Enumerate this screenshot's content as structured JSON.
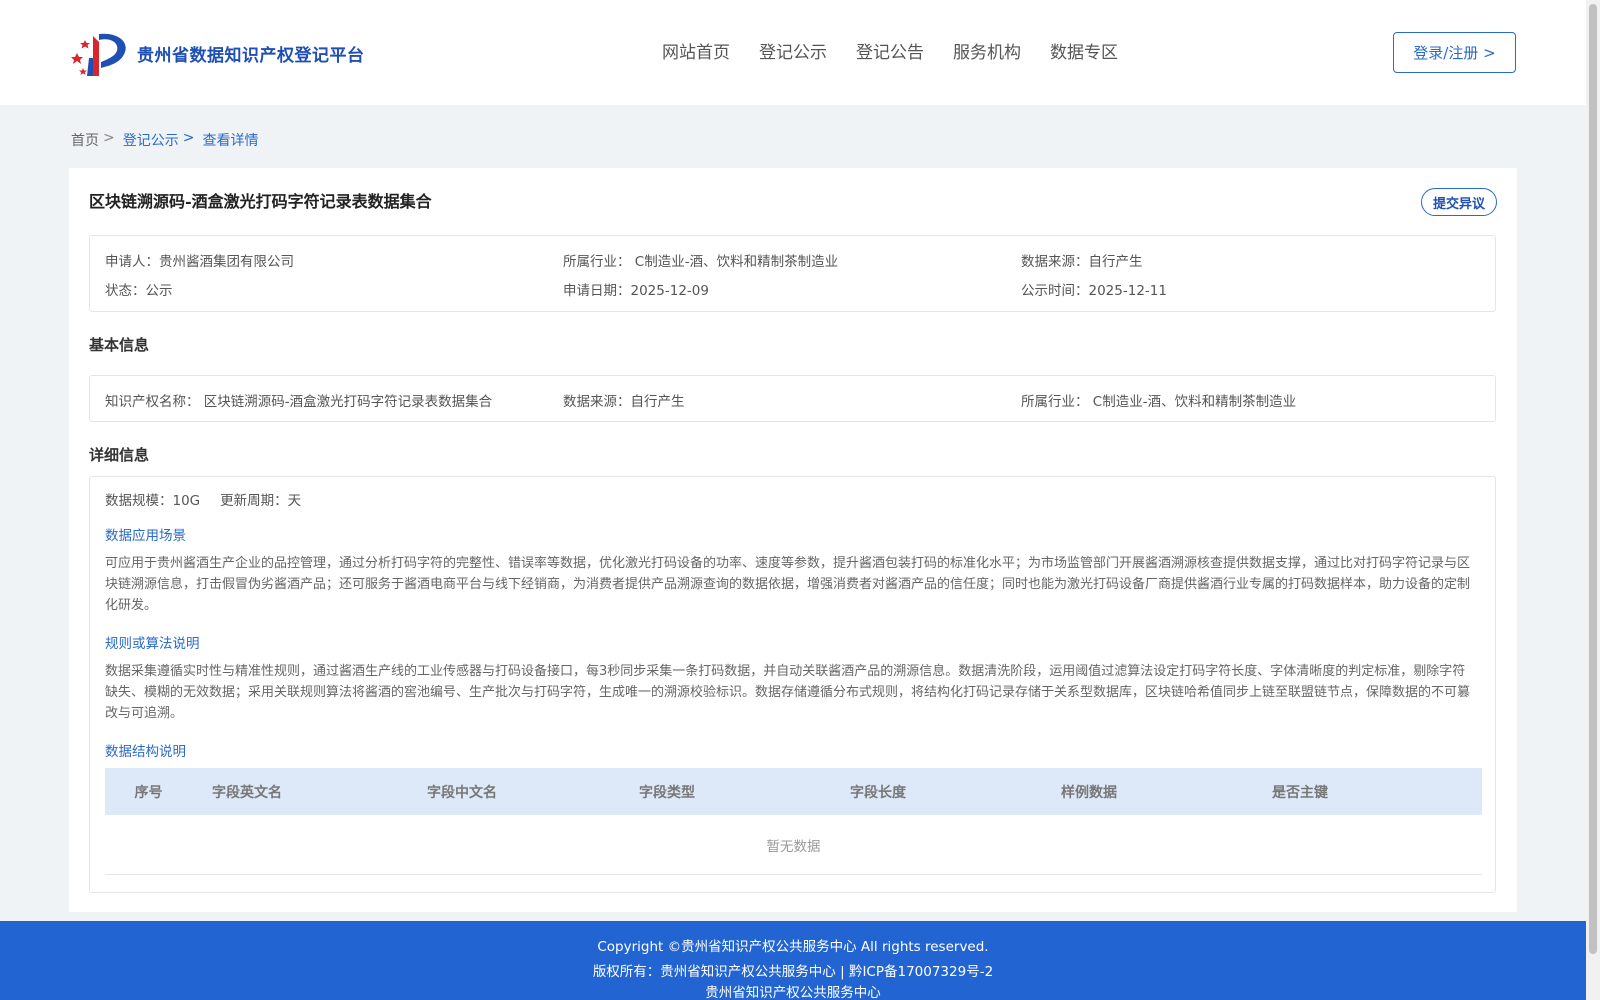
{
  "header": {
    "logo_text": "贵州省数据知识产权登记平台",
    "nav": [
      "网站首页",
      "登记公示",
      "登记公告",
      "服务机构",
      "数据专区"
    ],
    "login_label": "登录/注册 >"
  },
  "breadcrumb": {
    "home": "首页",
    "sep": ">",
    "parent": "登记公示",
    "current": "查看详情"
  },
  "record": {
    "title": "区块链溯源码-酒盒激光打码字符记录表数据集合",
    "objection_label": "提交异议",
    "applicant": "申请人：贵州酱酒集团有限公司",
    "industry": "所属行业： C制造业-酒、饮料和精制茶制造业",
    "source": "数据来源：自行产生",
    "status": "状态：公示",
    "apply_date": "申请日期：2025-12-09",
    "publish_date": "公示时间：2025-12-11"
  },
  "basic": {
    "section_title": "基本信息",
    "ip_name": "知识产权名称： 区块链溯源码-酒盒激光打码字符记录表数据集合",
    "source": "数据来源：自行产生",
    "industry": "所属行业： C制造业-酒、饮料和精制茶制造业"
  },
  "detail": {
    "section_title": "详细信息",
    "scale": "数据规模：10G",
    "cycle": "更新周期：天",
    "scenario_title": "数据应用场景",
    "scenario_text": "可应用于贵州酱酒生产企业的品控管理，通过分析打码字符的完整性、错误率等数据，优化激光打码设备的功率、速度等参数，提升酱酒包装打码的标准化水平；为市场监管部门开展酱酒溯源核查提供数据支撑，通过比对打码字符记录与区块链溯源信息，打击假冒伪劣酱酒产品；还可服务于酱酒电商平台与线下经销商，为消费者提供产品溯源查询的数据依据，增强消费者对酱酒产品的信任度；同时也能为激光打码设备厂商提供酱酒行业专属的打码数据样本，助力设备的定制化研发。",
    "rules_title": "规则或算法说明",
    "rules_text": "数据采集遵循实时性与精准性规则，通过酱酒生产线的工业传感器与打码设备接口，每3秒同步采集一条打码数据，并自动关联酱酒产品的溯源信息。数据清洗阶段，运用阈值过滤算法设定打码字符长度、字体清晰度的判定标准，剔除字符缺失、模糊的无效数据；采用关联规则算法将酱酒的窖池编号、生产批次与打码字符，生成唯一的溯源校验标识。数据存储遵循分布式规则，将结构化打码记录存储于关系型数据库，区块链哈希值同步上链至联盟链节点，保障数据的不可篡改与可追溯。",
    "structure_title": "数据结构说明",
    "table_headers": [
      "序号",
      "字段英文名",
      "字段中文名",
      "字段类型",
      "字段长度",
      "样例数据",
      "是否主键"
    ],
    "empty_text": "暂无数据"
  },
  "footer": {
    "copyright": "Copyright ©贵州省知识产权公共服务中心 All rights reserved.",
    "rights": "版权所有：贵州省知识产权公共服务中心 | 黔ICP备17007329号-2",
    "org": "贵州省知识产权公共服务中心"
  },
  "colors": {
    "accent": "#2a6ac9",
    "footer_bg": "#2264d1",
    "table_header_bg": "#dde9f8",
    "page_bg": "#f0f3f6"
  }
}
